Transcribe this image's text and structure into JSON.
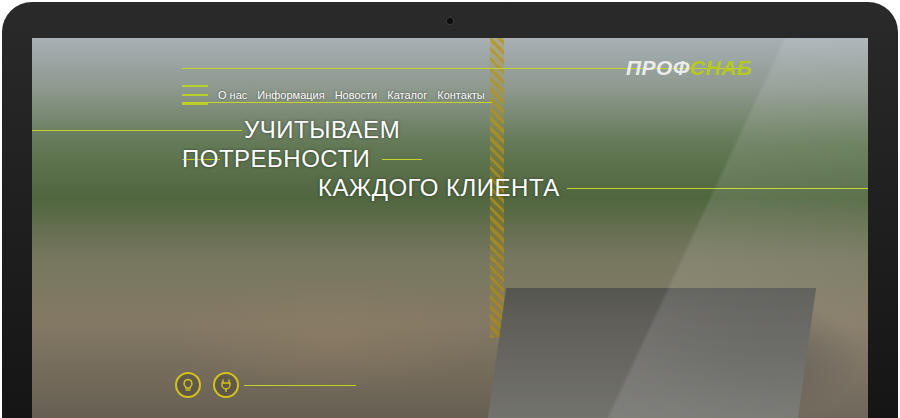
{
  "logo": {
    "part1": "ПРОФ",
    "part2": "СНАБ"
  },
  "nav": [
    {
      "label": "О нас"
    },
    {
      "label": "Информация"
    },
    {
      "label": "Новости"
    },
    {
      "label": "Каталог"
    },
    {
      "label": "Контакты"
    }
  ],
  "headline": [
    "УЧИТЫВАЕМ",
    "ПОТРЕБНОСТИ",
    "КАЖДОГО КЛИЕНТА"
  ]
}
